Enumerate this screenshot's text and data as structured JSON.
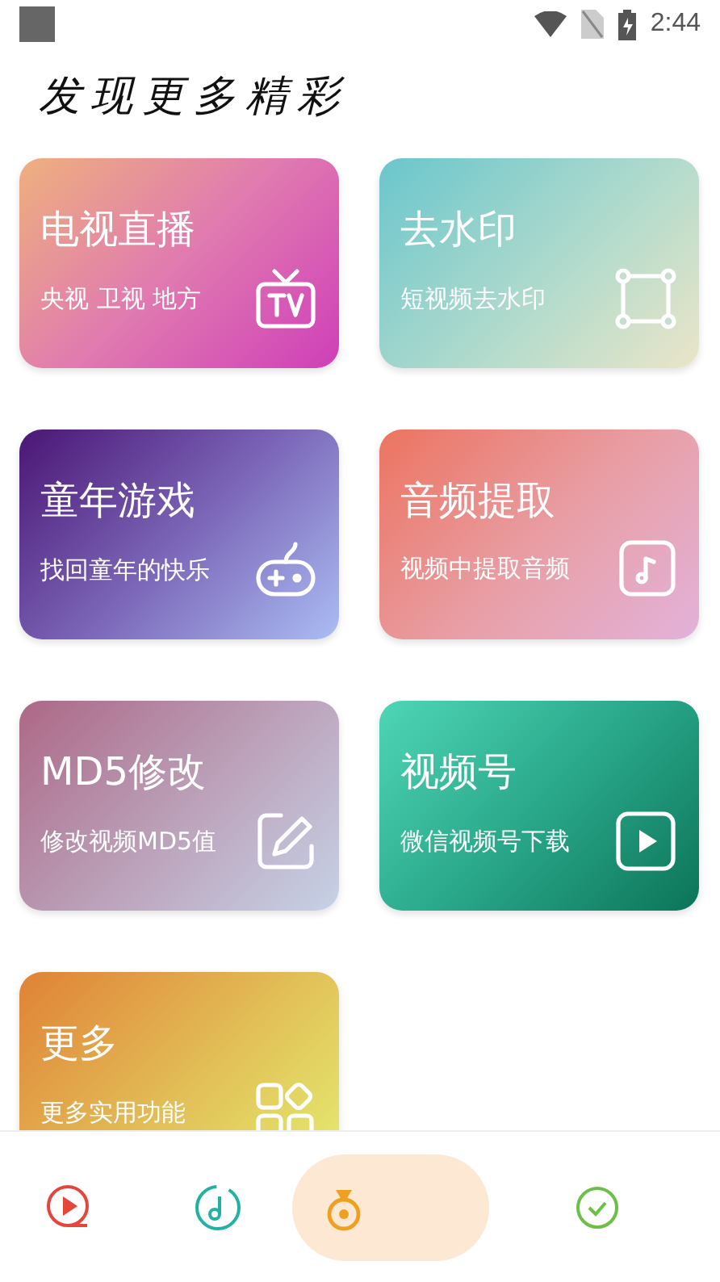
{
  "status_bar": {
    "time": "2:44"
  },
  "title": "发现更多精彩",
  "cards": [
    {
      "title": "电视直播",
      "subtitle": "央视 卫视 地方"
    },
    {
      "title": "去水印",
      "subtitle": "短视频去水印"
    },
    {
      "title": "童年游戏",
      "subtitle": "找回童年的快乐"
    },
    {
      "title": "音频提取",
      "subtitle": "视频中提取音频"
    },
    {
      "title": "MD5修改",
      "subtitle": "修改视频MD5值"
    },
    {
      "title": "视频号",
      "subtitle": "微信视频号下载"
    },
    {
      "title": "更多",
      "subtitle": "更多实用功能"
    }
  ],
  "nav": [
    {
      "selected": false
    },
    {
      "selected": false
    },
    {
      "selected": true
    },
    {
      "selected": false
    }
  ]
}
